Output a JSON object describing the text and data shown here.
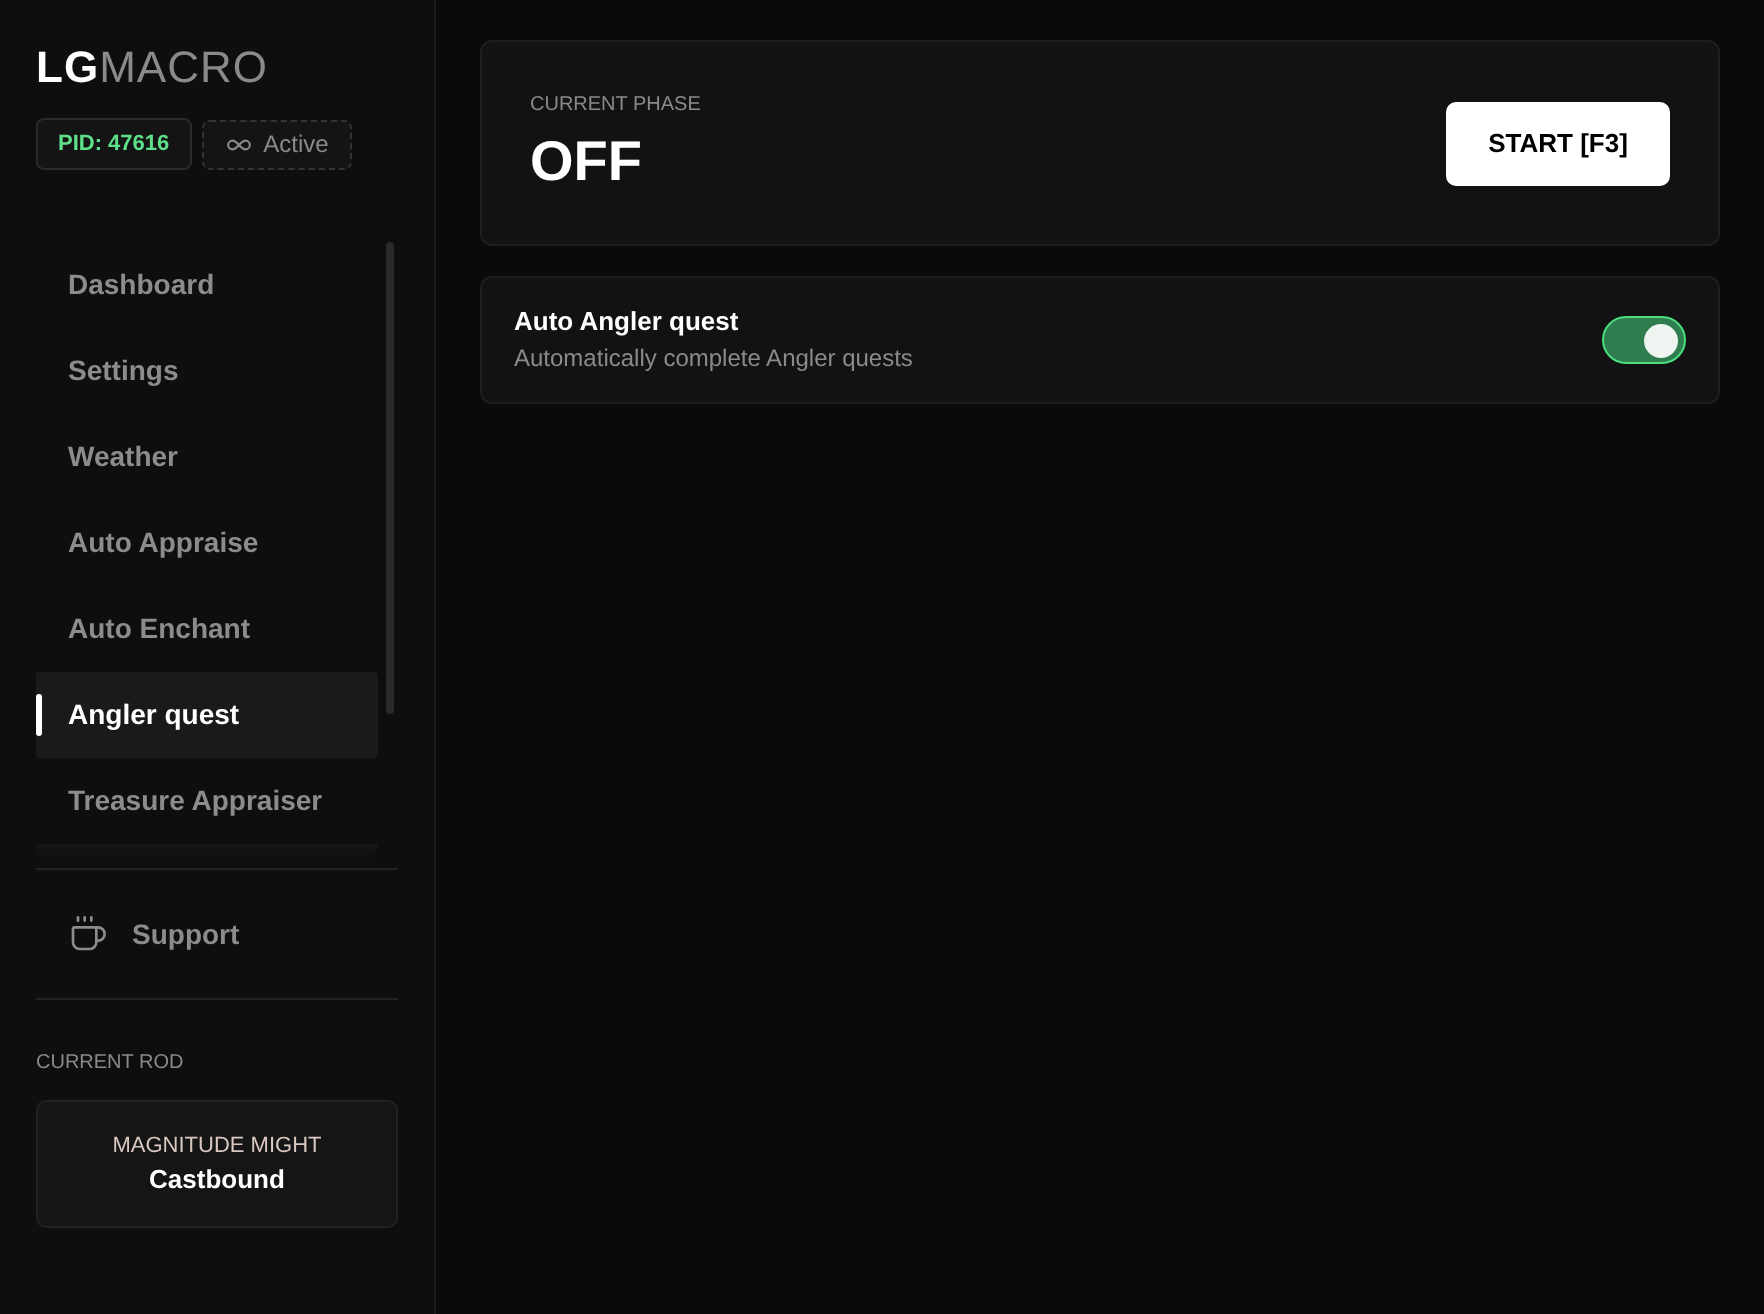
{
  "logo": {
    "primary": "LG",
    "secondary": "MACRO"
  },
  "badges": [
    {
      "kind": "pid",
      "label": "PID: 47616"
    },
    {
      "kind": "status",
      "label": "Active"
    }
  ],
  "nav": {
    "items": [
      {
        "label": "Dashboard",
        "selected": false
      },
      {
        "label": "Settings",
        "selected": false
      },
      {
        "label": "Weather",
        "selected": false
      },
      {
        "label": "Auto Appraise",
        "selected": false
      },
      {
        "label": "Auto Enchant",
        "selected": false
      },
      {
        "label": "Angler quest",
        "selected": true
      },
      {
        "label": "Treasure Appraiser",
        "selected": false
      }
    ]
  },
  "support": {
    "label": "Support"
  },
  "current_rod": {
    "heading": "CURRENT ROD",
    "category": "MAGNITUDE MIGHT",
    "name": "Castbound"
  },
  "phase_card": {
    "heading": "CURRENT PHASE",
    "value": "OFF",
    "button": "START [F3]"
  },
  "settings": [
    {
      "kind": "toggle",
      "title": "Auto Angler quest",
      "description": "Automatically complete Angler quests",
      "on": true
    }
  ]
}
